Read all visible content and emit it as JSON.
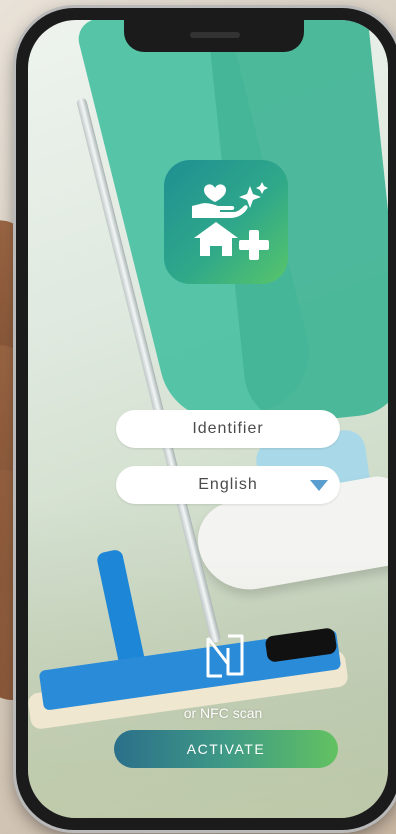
{
  "app": {
    "logo_icon": "care-home-plus-icon",
    "identifier_placeholder": "Identifier",
    "language_selected": "English",
    "nfc_label": "or NFC scan",
    "activate_label": "ACTIVATE"
  },
  "colors": {
    "accent_start": "#2b6f8a",
    "accent_end": "#62c261",
    "logo_start": "#1f8f92",
    "logo_end": "#58c56a",
    "dropdown_arrow": "#5a9ecf"
  }
}
